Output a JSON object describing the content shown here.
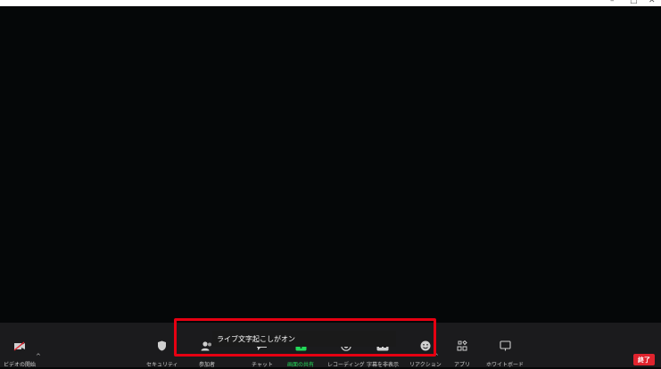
{
  "window": {
    "minimize_glyph": "–",
    "maximize_glyph": "□",
    "close_glyph": "✕"
  },
  "caption": {
    "text": "ライブ文字起こしがオン",
    "highlight_color": "#e60012"
  },
  "toolbar": {
    "video": {
      "label": "ビデオの開始",
      "icon": "video-off-icon"
    },
    "security": {
      "label": "セキュリティ",
      "icon": "shield-icon"
    },
    "participants": {
      "label": "参加者",
      "icon": "participants-icon"
    },
    "chat": {
      "label": "チャット",
      "icon": "chat-icon"
    },
    "share": {
      "label": "画面の共有",
      "icon": "share-screen-icon",
      "color": "#23d959"
    },
    "record": {
      "label": "レコーディング",
      "icon": "record-icon"
    },
    "cc": {
      "label": "字幕を非表示",
      "icon": "cc-icon"
    },
    "reactions": {
      "label": "リアクション",
      "icon": "reaction-icon"
    },
    "apps": {
      "label": "アプリ",
      "icon": "apps-icon"
    },
    "whiteboard": {
      "label": "ホワイトボード",
      "icon": "whiteboard-icon"
    },
    "end": {
      "label": "終了",
      "color": "#e0242e"
    }
  }
}
